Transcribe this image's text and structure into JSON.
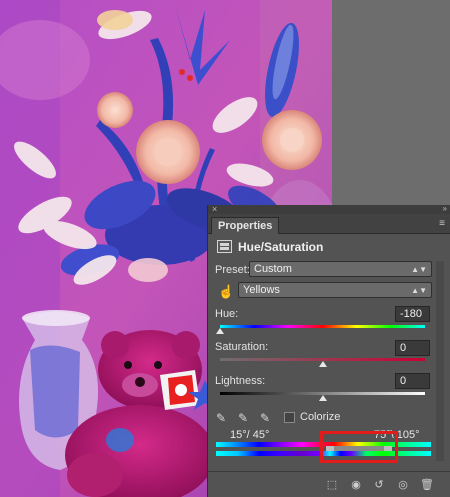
{
  "panel": {
    "close_glyph": "×",
    "collapse_glyph": "»",
    "tab_label": "Properties",
    "menu_glyph": "≡",
    "adjustment_title": "Hue/Saturation",
    "preset_label": "Preset:",
    "preset_value": "Custom",
    "channel_value": "Yellows",
    "hue_label": "Hue:",
    "hue_value": "-180",
    "hue_level": 0.0,
    "saturation_label": "Saturation:",
    "saturation_value": "0",
    "saturation_level": 0.5,
    "lightness_label": "Lightness:",
    "lightness_value": "0",
    "lightness_level": 0.5,
    "colorize_label": "Colorize",
    "colorize_checked": false,
    "range_left_text": "15°/ 45°",
    "range_right_text": "75°\\ 105°"
  },
  "icons": {
    "eyedropper": "eyedropper-icon",
    "eyedropper_add": "eyedropper-plus-icon",
    "eyedropper_subtract": "eyedropper-minus-icon",
    "target_adjust": "hand-target-icon",
    "clip": "clip-to-layer-icon",
    "view_previous": "view-previous-icon",
    "reset": "reset-icon",
    "visibility": "eye-icon",
    "delete": "trash-icon"
  },
  "colors": {
    "panel_bg": "#535353",
    "highlight": "#e21b1b"
  }
}
